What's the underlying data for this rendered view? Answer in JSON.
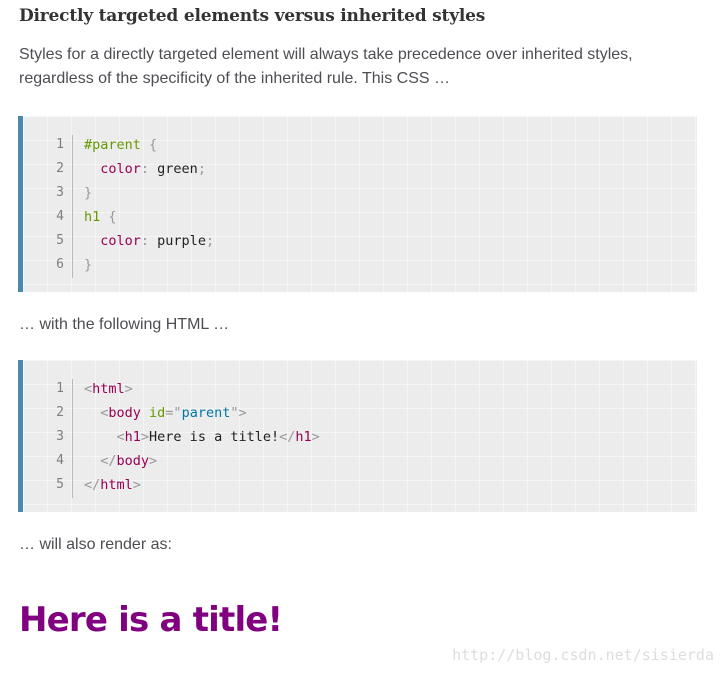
{
  "article": {
    "heading": "Directly targeted elements versus inherited styles",
    "intro": "Styles for a directly targeted element will always take precedence over inherited styles, regardless of the specificity of the inherited rule. This CSS …",
    "with_html": "… with the following HTML …",
    "render_as": "… will also render as:",
    "rendered_title": "Here is a title!"
  },
  "css_block": {
    "line_numbers": [
      "1",
      "2",
      "3",
      "4",
      "5",
      "6"
    ],
    "lines": [
      [
        {
          "t": "#parent",
          "c": "sel"
        },
        {
          "t": " {",
          "c": "punc"
        }
      ],
      [
        {
          "t": "  color",
          "c": "prop"
        },
        {
          "t": ":",
          "c": "punc"
        },
        {
          "t": " green",
          "c": "val"
        },
        {
          "t": ";",
          "c": "punc"
        }
      ],
      [
        {
          "t": "}",
          "c": "punc"
        }
      ],
      [
        {
          "t": "h1",
          "c": "sel"
        },
        {
          "t": " {",
          "c": "punc"
        }
      ],
      [
        {
          "t": "  color",
          "c": "prop"
        },
        {
          "t": ":",
          "c": "punc"
        },
        {
          "t": " purple",
          "c": "val"
        },
        {
          "t": ";",
          "c": "punc"
        }
      ],
      [
        {
          "t": "}",
          "c": "punc"
        }
      ]
    ]
  },
  "html_block": {
    "line_numbers": [
      "1",
      "2",
      "3",
      "4",
      "5"
    ],
    "lines": [
      [
        {
          "t": "<",
          "c": "punc"
        },
        {
          "t": "html",
          "c": "tag"
        },
        {
          "t": ">",
          "c": "punc"
        }
      ],
      [
        {
          "t": "  <",
          "c": "punc"
        },
        {
          "t": "body",
          "c": "tag"
        },
        {
          "t": " id",
          "c": "attr"
        },
        {
          "t": "=\"",
          "c": "punc"
        },
        {
          "t": "parent",
          "c": "str"
        },
        {
          "t": "\">",
          "c": "punc"
        }
      ],
      [
        {
          "t": "    <",
          "c": "punc"
        },
        {
          "t": "h1",
          "c": "tag"
        },
        {
          "t": ">",
          "c": "punc"
        },
        {
          "t": "Here is a title!",
          "c": "text"
        },
        {
          "t": "</",
          "c": "punc"
        },
        {
          "t": "h1",
          "c": "tag"
        },
        {
          "t": ">",
          "c": "punc"
        }
      ],
      [
        {
          "t": "  </",
          "c": "punc"
        },
        {
          "t": "body",
          "c": "tag"
        },
        {
          "t": ">",
          "c": "punc"
        }
      ],
      [
        {
          "t": "</",
          "c": "punc"
        },
        {
          "t": "html",
          "c": "tag"
        },
        {
          "t": ">",
          "c": "punc"
        }
      ]
    ]
  },
  "watermark": "http://blog.csdn.net/sisierda",
  "colors": {
    "code_background": "#ececec",
    "code_border": "#4a8aac",
    "title_purple": "#800080"
  }
}
